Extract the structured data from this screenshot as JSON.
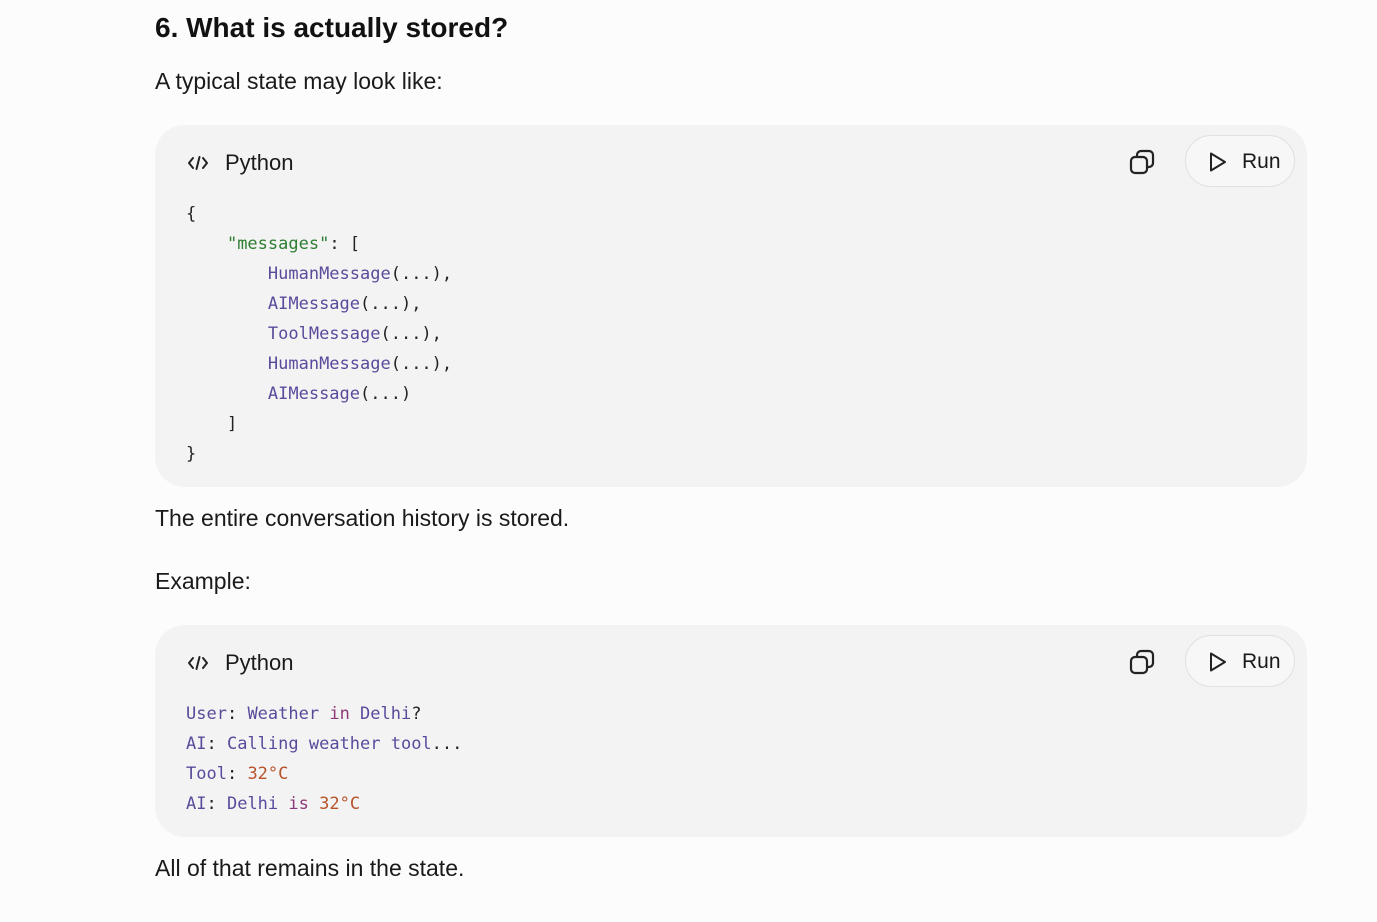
{
  "heading": "6. What is actually stored?",
  "intro": "A typical state may look like:",
  "code_block_1": {
    "language": "Python",
    "run_label": "Run",
    "lines": [
      [
        {
          "t": "{",
          "c": "pun"
        }
      ],
      [
        {
          "t": "    ",
          "c": "pun"
        },
        {
          "t": "\"messages\"",
          "c": "str"
        },
        {
          "t": ": [",
          "c": "pun"
        }
      ],
      [
        {
          "t": "        ",
          "c": "pun"
        },
        {
          "t": "HumanMessage",
          "c": "cls"
        },
        {
          "t": "(...),",
          "c": "pun"
        }
      ],
      [
        {
          "t": "        ",
          "c": "pun"
        },
        {
          "t": "AIMessage",
          "c": "cls"
        },
        {
          "t": "(...),",
          "c": "pun"
        }
      ],
      [
        {
          "t": "        ",
          "c": "pun"
        },
        {
          "t": "ToolMessage",
          "c": "cls"
        },
        {
          "t": "(...),",
          "c": "pun"
        }
      ],
      [
        {
          "t": "        ",
          "c": "pun"
        },
        {
          "t": "HumanMessage",
          "c": "cls"
        },
        {
          "t": "(...),",
          "c": "pun"
        }
      ],
      [
        {
          "t": "        ",
          "c": "pun"
        },
        {
          "t": "AIMessage",
          "c": "cls"
        },
        {
          "t": "(...)",
          "c": "pun"
        }
      ],
      [
        {
          "t": "    ]",
          "c": "pun"
        }
      ],
      [
        {
          "t": "}",
          "c": "pun"
        }
      ]
    ]
  },
  "after_code_1": "The entire conversation history is stored.",
  "example_label": "Example:",
  "code_block_2": {
    "language": "Python",
    "run_label": "Run",
    "lines": [
      [
        {
          "t": "User",
          "c": "cls"
        },
        {
          "t": ": ",
          "c": "pun"
        },
        {
          "t": "Weather ",
          "c": "cls"
        },
        {
          "t": "in",
          "c": "kw"
        },
        {
          "t": " Delhi",
          "c": "cls"
        },
        {
          "t": "?",
          "c": "pun"
        }
      ],
      [
        {
          "t": "AI",
          "c": "cls"
        },
        {
          "t": ": ",
          "c": "pun"
        },
        {
          "t": "Calling weather tool",
          "c": "cls"
        },
        {
          "t": "...",
          "c": "pun"
        }
      ],
      [
        {
          "t": "Tool",
          "c": "cls"
        },
        {
          "t": ": ",
          "c": "pun"
        },
        {
          "t": "32°C",
          "c": "num"
        }
      ],
      [
        {
          "t": "AI",
          "c": "cls"
        },
        {
          "t": ": ",
          "c": "pun"
        },
        {
          "t": "Delhi ",
          "c": "cls"
        },
        {
          "t": "is",
          "c": "kw"
        },
        {
          "t": " ",
          "c": "pun"
        },
        {
          "t": "32°C",
          "c": "num"
        }
      ]
    ]
  },
  "closing": "All of that remains in the state.",
  "icons": {
    "language": "code-brackets-icon",
    "copy": "copy-icon",
    "run": "play-icon"
  },
  "colors": {
    "page_background": "#fcfcfc",
    "code_card_background": "#f3f3f3",
    "string_token": "#2e7d32",
    "class_token": "#5b4a9c",
    "keyword_token": "#8e3a7a",
    "number_token": "#b8542a"
  }
}
